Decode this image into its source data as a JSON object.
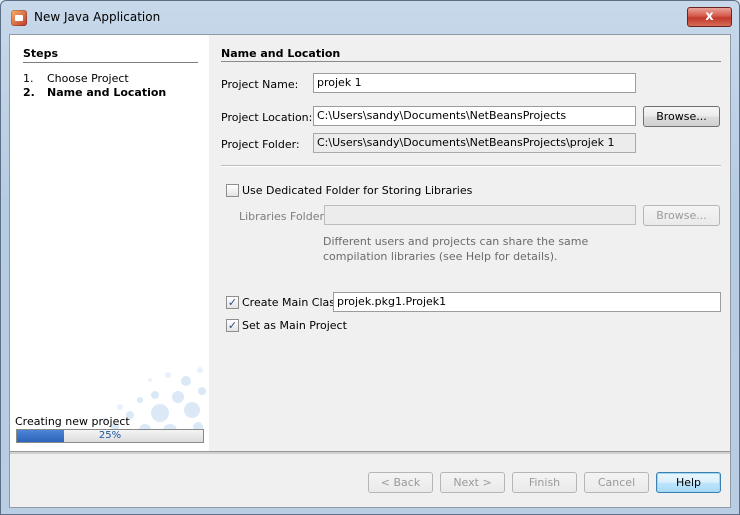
{
  "window": {
    "title": "New Java Application",
    "close_label": "x"
  },
  "steps": {
    "title": "Steps",
    "items": [
      {
        "num": "1.",
        "label": "Choose Project"
      },
      {
        "num": "2.",
        "label": "Name and Location"
      }
    ],
    "progress_label": "Creating new project",
    "progress_percent": 25,
    "progress_text": "25%"
  },
  "form": {
    "section_title": "Name and Location",
    "project_name_label": "Project Name:",
    "project_name_value": "projek 1",
    "project_location_label": "Project Location:",
    "project_location_value": "C:\\Users\\sandy\\Documents\\NetBeansProjects",
    "browse_label": "Browse...",
    "project_folder_label": "Project Folder:",
    "project_folder_value": "C:\\Users\\sandy\\Documents\\NetBeansProjects\\projek 1",
    "dedicated_folder_label": "Use Dedicated Folder for Storing Libraries",
    "dedicated_folder_checked": false,
    "libraries_folder_label": "Libraries Folder:",
    "libraries_folder_value": "",
    "libraries_browse_label": "Browse...",
    "hint_text": "Different users and projects can share the same compilation libraries (see Help for details).",
    "create_main_class_label": "Create Main Class",
    "create_main_class_checked": true,
    "main_class_value": "projek.pkg1.Projek1",
    "set_main_project_label": "Set as Main Project",
    "set_main_project_checked": true,
    "check_glyph": "✓"
  },
  "footer": {
    "back_label": "< Back",
    "next_label": "Next >",
    "finish_label": "Finish",
    "cancel_label": "Cancel",
    "help_label": "Help"
  },
  "colors": {
    "progress_fill": "#2b64b9",
    "close_button": "#c0392b"
  }
}
